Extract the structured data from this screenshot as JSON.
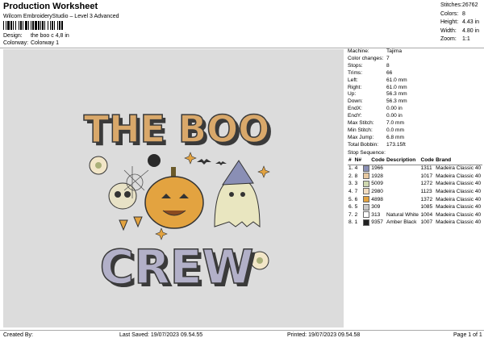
{
  "header": {
    "title": "Production Worksheet",
    "subtitle": "Wilcom EmbroideryStudio – Level 3 Advanced"
  },
  "design": {
    "label": "Design:",
    "value": "the boo c 4,8 in"
  },
  "colorway": {
    "label": "Colorway:",
    "value": "Colorway 1"
  },
  "summary": [
    {
      "label": "Stitches:",
      "value": "26762"
    },
    {
      "label": "Colors:",
      "value": "8"
    },
    {
      "label": "Height:",
      "value": "4.43 in"
    },
    {
      "label": "Width:",
      "value": "4.80 in"
    },
    {
      "label": "Zoom:",
      "value": "1:1"
    }
  ],
  "machine_info": [
    {
      "label": "Machine:",
      "value": "Tajima"
    },
    {
      "label": "Color changes:",
      "value": "7"
    },
    {
      "label": "Stops:",
      "value": "8"
    },
    {
      "label": "Trims:",
      "value": "66"
    },
    {
      "label": "Left:",
      "value": "61.0 mm"
    },
    {
      "label": "Right:",
      "value": "61.0 mm"
    },
    {
      "label": "Up:",
      "value": "56.3 mm"
    },
    {
      "label": "Down:",
      "value": "56.3 mm"
    },
    {
      "label": "EndX:",
      "value": "0.00 in"
    },
    {
      "label": "EndY:",
      "value": "0.00 in"
    },
    {
      "label": "Max Stitch:",
      "value": "7.0 mm"
    },
    {
      "label": "Min Stitch:",
      "value": "0.0 mm"
    },
    {
      "label": "Max Jump:",
      "value": "6.8 mm"
    },
    {
      "label": "Total Bobbin:",
      "value": "173.15ft"
    }
  ],
  "stop_sequence": {
    "heading": "Stop Sequence:",
    "columns": [
      "#",
      "N#",
      "Code",
      "Description",
      "Code",
      "Brand"
    ],
    "rows": [
      {
        "n": "1.",
        "needle": "4",
        "color": "#8a8fb5",
        "code": "1966",
        "desc": "",
        "tcode": "1311",
        "brand": "Madeira Classic 40"
      },
      {
        "n": "2.",
        "needle": "8",
        "color": "#e8c9a0",
        "code": "1928",
        "desc": "",
        "tcode": "1017",
        "brand": "Madeira Classic 40"
      },
      {
        "n": "3.",
        "needle": "3",
        "color": "#cfd8b0",
        "code": "5009",
        "desc": "",
        "tcode": "1272",
        "brand": "Madeira Classic 40"
      },
      {
        "n": "4.",
        "needle": "7",
        "color": "#f2dcc0",
        "code": "2980",
        "desc": "",
        "tcode": "1123",
        "brand": "Madeira Classic 40"
      },
      {
        "n": "5.",
        "needle": "6",
        "color": "#e3a340",
        "code": "4898",
        "desc": "",
        "tcode": "1372",
        "brand": "Madeira Classic 40"
      },
      {
        "n": "6.",
        "needle": "5",
        "color": "#c8c8c8",
        "code": "309",
        "desc": "",
        "tcode": "1085",
        "brand": "Madeira Classic 40"
      },
      {
        "n": "7.",
        "needle": "2",
        "color": "#ffffff",
        "code": "313",
        "desc": "Natural White",
        "tcode": "1004",
        "brand": "Madeira Classic 40"
      },
      {
        "n": "8.",
        "needle": "1",
        "color": "#222222",
        "code": "9357",
        "desc": "Amber Black",
        "tcode": "1007",
        "brand": "Madeira Classic 40"
      }
    ]
  },
  "artwork": {
    "line1": "THE BOO",
    "line2": "CREW"
  },
  "footer": {
    "created_by": "Created By:",
    "last_saved": "Last Saved: 19/07/2023 09.54.55",
    "printed": "Printed: 19/07/2023 09.54.58",
    "page": "Page 1 of 1"
  }
}
